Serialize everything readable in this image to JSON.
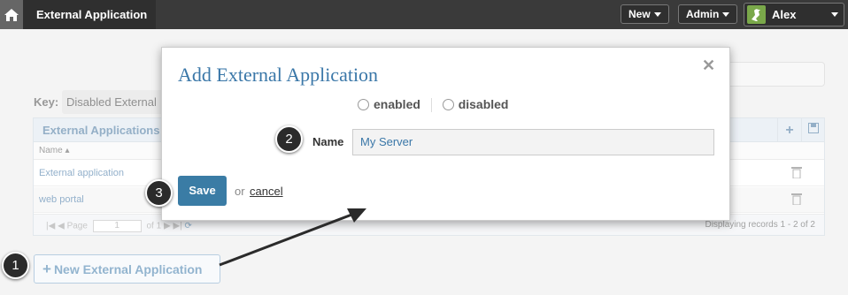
{
  "topbar": {
    "breadcrumb": "External Applications",
    "new_label": "New",
    "admin_label": "Admin",
    "user_name": "Alex"
  },
  "page": {
    "key_label": "Key:",
    "key_select_value": "Disabled External",
    "grid_title": "External Applications",
    "col_name": "Name ▴",
    "rows": [
      {
        "name": "External application"
      },
      {
        "name": "web portal"
      }
    ],
    "pager_page_label": "Page",
    "pager_page_value": "1",
    "pager_of": "of 1",
    "pager_info": "Displaying records 1 - 2 of 2",
    "new_button_label": "New External Application"
  },
  "modal": {
    "title": "Add External Application",
    "radio_enabled": "enabled",
    "radio_disabled": "disabled",
    "name_label": "Name",
    "name_value": "My Server",
    "save_label": "Save",
    "or_text": "or",
    "cancel_label": "cancel"
  },
  "callouts": {
    "one": "1",
    "two": "2",
    "three": "3"
  },
  "colors": {
    "accent": "#3a77a8",
    "save_button": "#3a7ca5",
    "topbar": "#3a3a3a"
  },
  "icons": [
    "home-icon",
    "caret-down-icon",
    "avatar-bird-icon",
    "plus-icon",
    "save-disk-icon",
    "trash-icon",
    "pager-first-icon",
    "pager-prev-icon",
    "pager-next-icon",
    "pager-last-icon",
    "refresh-icon",
    "close-icon"
  ]
}
